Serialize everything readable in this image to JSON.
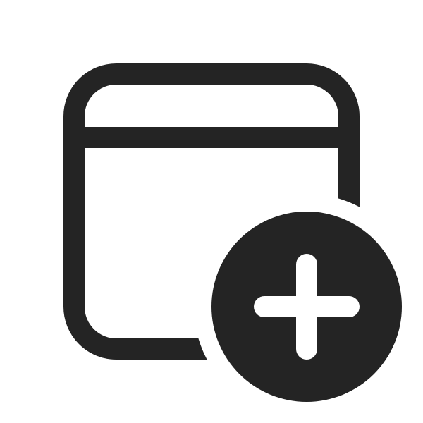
{
  "icon": {
    "name": "window-add-icon",
    "color": "#242424",
    "background": "#ffffff"
  }
}
